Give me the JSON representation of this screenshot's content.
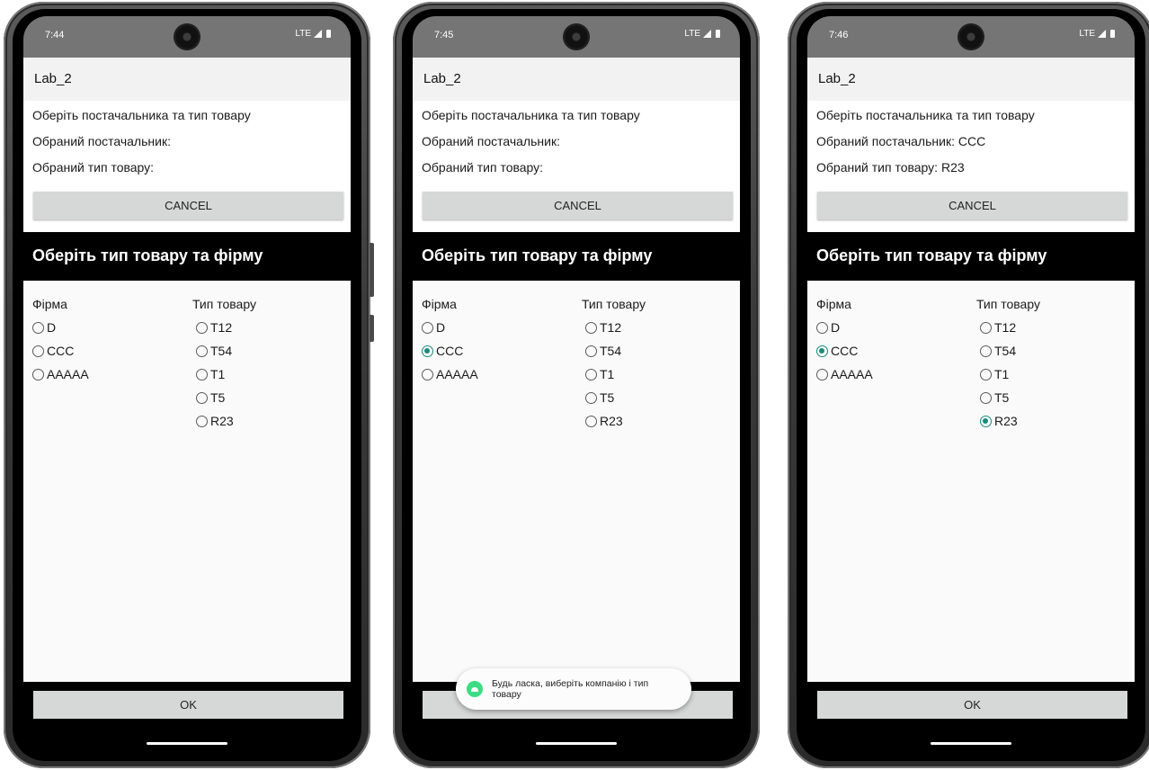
{
  "screens": [
    {
      "status_time": "7:44",
      "status_network": "LTE",
      "app_title": "Lab_2",
      "prompt": "Оберіть постачальника та тип товару",
      "selected_supplier": "Обраний постачальник:",
      "selected_type": "Обраний тип товару:",
      "cancel_label": "CANCEL",
      "dialog_title": "Оберіть тип товару та фірму",
      "firm_header": "Фірма",
      "type_header": "Тип товару",
      "firms": [
        {
          "label": "D",
          "checked": false
        },
        {
          "label": "CCC",
          "checked": false
        },
        {
          "label": "AAAAA",
          "checked": false
        }
      ],
      "types": [
        {
          "label": "T12",
          "checked": false
        },
        {
          "label": "T54",
          "checked": false
        },
        {
          "label": "T1",
          "checked": false
        },
        {
          "label": "T5",
          "checked": false
        },
        {
          "label": "R23",
          "checked": false
        }
      ],
      "ok_label": "OK",
      "toast": null
    },
    {
      "status_time": "7:45",
      "status_network": "LTE",
      "app_title": "Lab_2",
      "prompt": "Оберіть постачальника та тип товару",
      "selected_supplier": "Обраний постачальник:",
      "selected_type": "Обраний тип товару:",
      "cancel_label": "CANCEL",
      "dialog_title": "Оберіть тип товару та фірму",
      "firm_header": "Фірма",
      "type_header": "Тип товару",
      "firms": [
        {
          "label": "D",
          "checked": false
        },
        {
          "label": "CCC",
          "checked": true
        },
        {
          "label": "AAAAA",
          "checked": false
        }
      ],
      "types": [
        {
          "label": "T12",
          "checked": false
        },
        {
          "label": "T54",
          "checked": false
        },
        {
          "label": "T1",
          "checked": false
        },
        {
          "label": "T5",
          "checked": false
        },
        {
          "label": "R23",
          "checked": false
        }
      ],
      "ok_label": "OK",
      "toast": "Будь ласка, виберіть компанію і тип товару"
    },
    {
      "status_time": "7:46",
      "status_network": "LTE",
      "app_title": "Lab_2",
      "prompt": "Оберіть постачальника та тип товару",
      "selected_supplier": "Обраний постачальник: CCC",
      "selected_type": "Обраний тип товару: R23",
      "cancel_label": "CANCEL",
      "dialog_title": "Оберіть тип товару та фірму",
      "firm_header": "Фірма",
      "type_header": "Тип товару",
      "firms": [
        {
          "label": "D",
          "checked": false
        },
        {
          "label": "CCC",
          "checked": true
        },
        {
          "label": "AAAAA",
          "checked": false
        }
      ],
      "types": [
        {
          "label": "T12",
          "checked": false
        },
        {
          "label": "T54",
          "checked": false
        },
        {
          "label": "T1",
          "checked": false
        },
        {
          "label": "T5",
          "checked": false
        },
        {
          "label": "R23",
          "checked": true
        }
      ],
      "ok_label": "OK",
      "toast": null
    }
  ],
  "colors": {
    "status_bar": "#757575",
    "action_bar": "#f2f2f2",
    "dialog_header": "#000000",
    "button": "#d6d7d7",
    "radio_accent": "#1a8a7c",
    "toast_icon": "#3ddc84"
  },
  "icons": [
    "signal-icon",
    "battery-icon",
    "camera-icon",
    "android-icon",
    "home-indicator"
  ]
}
